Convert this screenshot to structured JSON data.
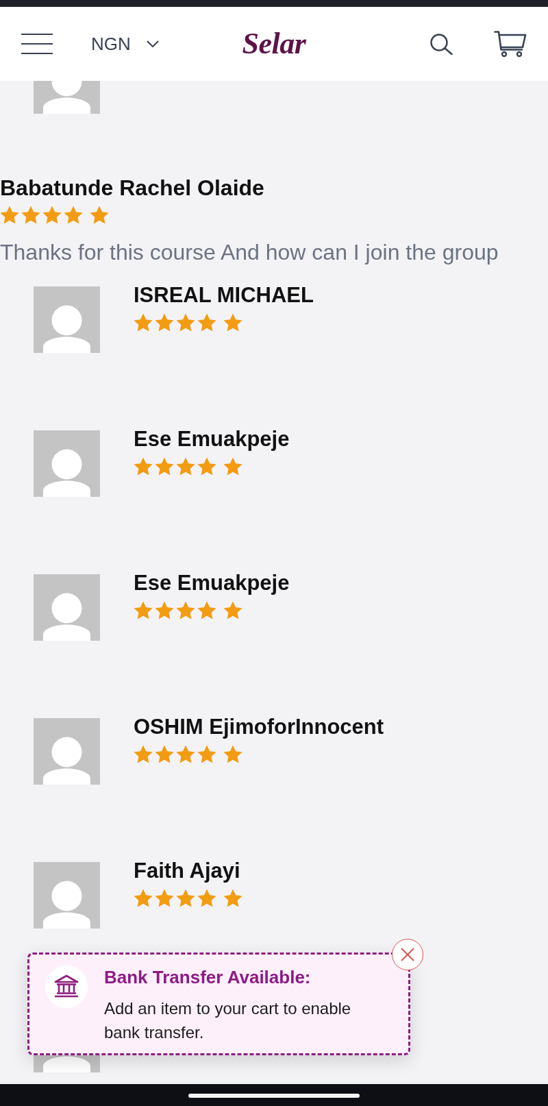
{
  "header": {
    "currency": "NGN",
    "logo": "Selar"
  },
  "reviews": [
    {
      "kind": "avatar"
    },
    {
      "kind": "comment",
      "name": "Babatunde Rachel Olaide",
      "stars": 5,
      "text": "Thanks for this course And how can I join the group"
    },
    {
      "kind": "avatar",
      "name": "ISREAL MICHAEL",
      "stars": 5
    },
    {
      "kind": "avatar",
      "name": "Ese Emuakpeje",
      "stars": 5
    },
    {
      "kind": "avatar",
      "name": "Ese Emuakpeje",
      "stars": 5
    },
    {
      "kind": "avatar",
      "name": "OSHIM EjimoforInnocent",
      "stars": 5
    },
    {
      "kind": "avatar",
      "name": "Faith Ajayi",
      "stars": 5
    },
    {
      "kind": "avatar"
    }
  ],
  "toast": {
    "title": "Bank Transfer Available:",
    "message": "Add an item to your cart to enable bank transfer."
  }
}
